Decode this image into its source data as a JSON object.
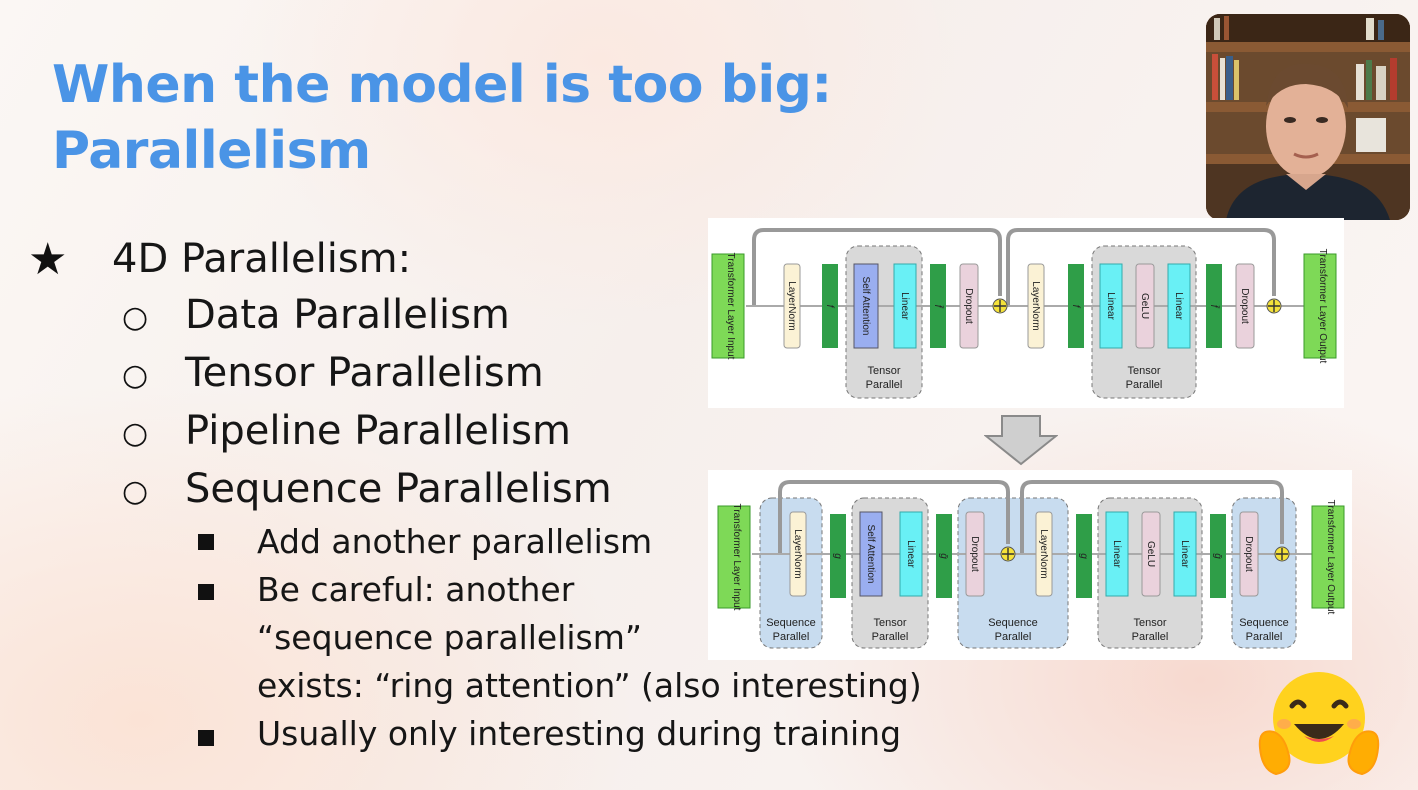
{
  "slide": {
    "title_line1": "When the model is too big:",
    "title_line2": "Parallelism",
    "bullet_main": "4D Parallelism:",
    "sub_bullets": [
      "Data Parallelism",
      "Tensor Parallelism",
      "Pipeline Parallelism",
      "Sequence Parallelism"
    ],
    "sub_sub_bullets": {
      "item1": "Add another parallelism",
      "item2_line1": "Be careful: another",
      "item2_line2": "“sequence parallelism”",
      "item2_line3": "exists: “ring attention” (also interesting)",
      "item3": "Usually only interesting during training"
    }
  },
  "diagram_top": {
    "input": "Transformer Layer Input",
    "layernorm1": "LayerNorm",
    "f1": "f",
    "self_attention": "Self Attention",
    "linear1": "Linear",
    "fbar1": "f̄",
    "dropout1": "Dropout",
    "layernorm2": "LayerNorm",
    "f2": "f",
    "linear2": "Linear",
    "gelu": "GeLU",
    "linear3": "Linear",
    "fbar2": "f̄",
    "dropout2": "Dropout",
    "output": "Transformer Layer Output",
    "group1_l1": "Tensor",
    "group1_l2": "Parallel",
    "group2_l1": "Tensor",
    "group2_l2": "Parallel"
  },
  "diagram_bottom": {
    "input": "Transformer Layer Input",
    "layernorm1": "LayerNorm",
    "g1": "g",
    "self_attention": "Self Attention",
    "linear1": "Linear",
    "gbar1": "ḡ",
    "dropout1": "Dropout",
    "layernorm2": "LayerNorm",
    "g2": "g",
    "linear2": "Linear",
    "gelu": "GeLU",
    "linear3": "Linear",
    "gbar2": "ḡ",
    "dropout2": "Dropout",
    "output": "Transformer Layer Output",
    "seq1_l1": "Sequence",
    "seq1_l2": "Parallel",
    "ten1_l1": "Tensor",
    "ten1_l2": "Parallel",
    "seq2_l1": "Sequence",
    "seq2_l2": "Parallel",
    "ten2_l1": "Tensor",
    "ten2_l2": "Parallel",
    "seq3_l1": "Sequence",
    "seq3_l2": "Parallel"
  },
  "colors": {
    "title": "#4a94e6",
    "green": "#7ed957",
    "dark_green": "#2f9e48",
    "cyan": "#69f0f5",
    "blue_box": "#9aaef0",
    "pink": "#ead2dc",
    "cream": "#fbf2d5"
  }
}
